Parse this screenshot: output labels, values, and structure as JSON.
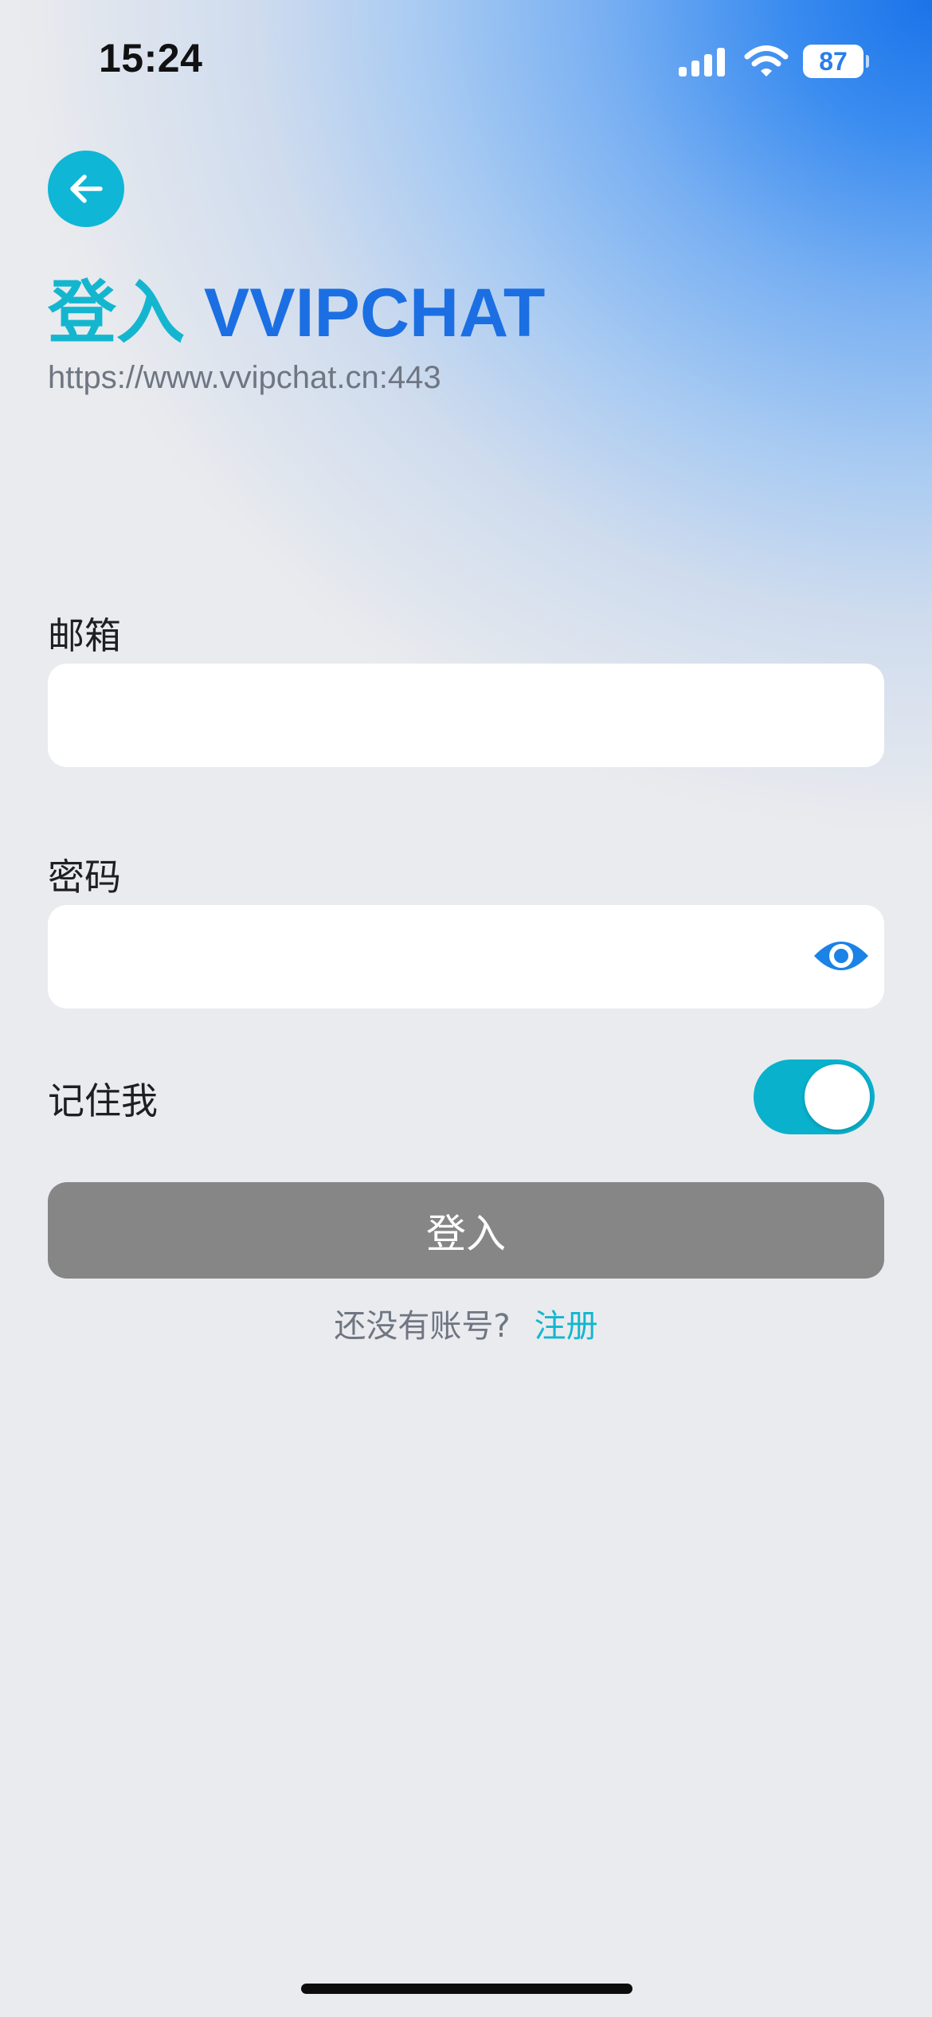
{
  "status_bar": {
    "time": "15:24",
    "battery": "87",
    "icons": [
      "signal-icon",
      "wifi-icon",
      "battery-icon"
    ]
  },
  "header": {
    "back_icon": "arrow-left-icon",
    "title_prefix": "登入",
    "title_brand": "VVIPCHAT",
    "server_url": "https://www.vvipchat.cn:443"
  },
  "form": {
    "email": {
      "label": "邮箱",
      "value": "",
      "placeholder": ""
    },
    "password": {
      "label": "密码",
      "value": "",
      "placeholder": "",
      "toggle_icon": "eye-icon"
    },
    "remember": {
      "label": "记住我",
      "checked": true
    },
    "submit_label": "登入"
  },
  "footer": {
    "prompt": "还没有账号?",
    "register_link": "注册"
  },
  "colors": {
    "accent": "#14b6cf",
    "brand_blue": "#1b6fe3",
    "button_disabled": "#868686",
    "background": "#eaebee"
  }
}
